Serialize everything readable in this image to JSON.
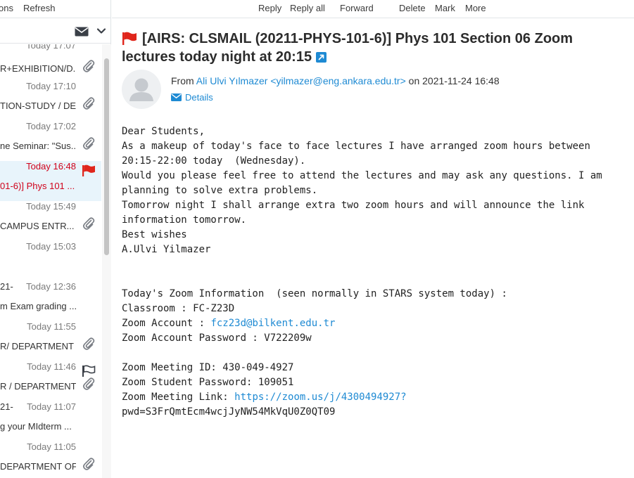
{
  "left_toolbar": {
    "options_label": "ons",
    "refresh_label": "Refresh"
  },
  "icons": {
    "envelope": "envelope-icon",
    "chevron": "chevron-down-icon",
    "paperclip": "paperclip-icon",
    "flag_filled": "flag-filled-icon",
    "flag_outline": "flag-outline-icon",
    "external_link": "external-link-icon",
    "avatar": "user-avatar-icon"
  },
  "colors": {
    "accent": "#1e8ad3",
    "flag": "#e0251b",
    "selected_bg": "#e8f4fb",
    "selected_text": "#d0021b"
  },
  "messages": [
    {
      "date": "Today 17:07",
      "subject": "",
      "prefix": "",
      "attachment": false,
      "flag": "none",
      "selected": false
    },
    {
      "date": "",
      "subject": "R+EXHIBITION/D...",
      "prefix": "",
      "attachment": true,
      "flag": "none",
      "selected": false
    },
    {
      "date": "Today 17:10",
      "subject": "TION-STUDY / DE...",
      "prefix": "",
      "attachment": true,
      "flag": "none",
      "selected": false
    },
    {
      "date": "Today 17:02",
      "subject": "ne Seminar: \"Sus...",
      "prefix": "",
      "attachment": true,
      "flag": "none",
      "selected": false
    },
    {
      "date": "Today 16:48",
      "subject": "01-6)] Phys 101 ...",
      "prefix": "",
      "attachment": false,
      "flag": "filled",
      "selected": true
    },
    {
      "date": "Today 15:49",
      "subject": "CAMPUS ENTR...",
      "prefix": "",
      "attachment": true,
      "flag": "none",
      "selected": false
    },
    {
      "date": "Today 15:03",
      "subject": "",
      "prefix": "",
      "attachment": false,
      "flag": "none",
      "selected": false
    },
    {
      "date": "Today 12:36",
      "subject": "m Exam grading ...",
      "prefix": "21-",
      "attachment": false,
      "flag": "none",
      "selected": false
    },
    {
      "date": "Today 11:55",
      "subject": "R/ DEPARTMENT ...",
      "prefix": "",
      "attachment": true,
      "flag": "none",
      "selected": false
    },
    {
      "date": "Today 11:46",
      "subject": "R / DEPARTMENT...",
      "prefix": "",
      "attachment": true,
      "flag": "outline",
      "selected": false
    },
    {
      "date": "Today 11:07",
      "subject": "g your MIdterm ...",
      "prefix": "21-",
      "attachment": false,
      "flag": "none",
      "selected": false
    },
    {
      "date": "Today 11:05",
      "subject": "DEPARTMENT OF...",
      "prefix": "",
      "attachment": true,
      "flag": "none",
      "selected": false
    }
  ],
  "toolbar": {
    "reply": "Reply",
    "reply_all": "Reply all",
    "forward": "Forward",
    "delete": "Delete",
    "mark": "Mark",
    "more": "More"
  },
  "email": {
    "subject": "[AIRS: CLSMAIL (20211-PHYS-101-6)] Phys 101 Section 06 Zoom lectures today night at 20:15",
    "from_label": "From",
    "sender": "Ali Ulvi Yılmazer <yilmazer@eng.ankara.edu.tr>",
    "on_label": "on",
    "date": "2021-11-24 16:48",
    "details_label": "Details",
    "body": {
      "l1": "Dear Students,",
      "l2": "As a makeup of today's face to face lectures I have arranged zoom hours between",
      "l3": "20:15-22:00 today  (Wednesday).",
      "l4": "Would you please feel free to attend the lectures and may ask any questions. I am",
      "l5": "planning to solve extra problems.",
      "l6": "Tomorrow night I shall arrange extra two zoom hours and will announce the link",
      "l7": "information tomorrow.",
      "l8": "Best wishes",
      "l9": "A.Ulvi Yilmazer",
      "l10": "Today's Zoom Information  (seen normally in STARS system today) :",
      "l11": "Classroom : FC-Z23D",
      "l12_label": "Zoom Account : ",
      "l12_link": "fcz23d@bilkent.edu.tr",
      "l13": "Zoom Account Password : V722209w",
      "l14": "Zoom Meeting ID: 430-049-4927",
      "l15": "Zoom Student Password: 109051",
      "l16_label": "Zoom Meeting Link: ",
      "l16_link": "https://zoom.us/j/4300494927?",
      "l17": "pwd=S3FrQmtEcm4wcjJyNW54MkVqU0Z0QT09"
    }
  }
}
